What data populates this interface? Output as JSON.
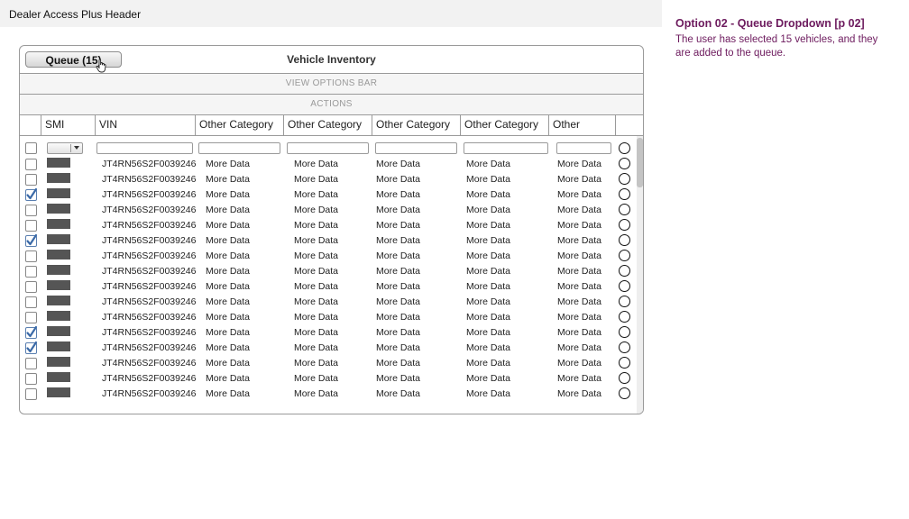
{
  "header": {
    "title": "Dealer Access Plus Header"
  },
  "note": {
    "title": "Option 02 - Queue Dropdown [p 02]",
    "body": "The user has selected 15 vehicles, and they are added to the queue."
  },
  "panel": {
    "queue_button": "Queue (15)",
    "title": "Vehicle Inventory",
    "view_options_bar": "VIEW OPTIONS BAR",
    "actions_bar": "ACTIONS"
  },
  "columns": [
    "SMI",
    "VIN",
    "Other Category",
    "Other Category",
    "Other Category",
    "Other Category",
    "Other"
  ],
  "rows": [
    {
      "vin": "JT4RN56S2F0039246",
      "checked": false,
      "c1": "More Data",
      "c2": "More Data",
      "c3": "More Data",
      "c4": "More Data",
      "c5": "More Data"
    },
    {
      "vin": "JT4RN56S2F0039246",
      "checked": false,
      "c1": "More Data",
      "c2": "More Data",
      "c3": "More Data",
      "c4": "More Data",
      "c5": "More Data"
    },
    {
      "vin": "JT4RN56S2F0039246",
      "checked": true,
      "c1": "More Data",
      "c2": "More Data",
      "c3": "More Data",
      "c4": "More Data",
      "c5": "More Data"
    },
    {
      "vin": "JT4RN56S2F0039246",
      "checked": false,
      "c1": "More Data",
      "c2": "More Data",
      "c3": "More Data",
      "c4": "More Data",
      "c5": "More Data"
    },
    {
      "vin": "JT4RN56S2F0039246",
      "checked": false,
      "c1": "More Data",
      "c2": "More Data",
      "c3": "More Data",
      "c4": "More Data",
      "c5": "More Data"
    },
    {
      "vin": "JT4RN56S2F0039246",
      "checked": true,
      "c1": "More Data",
      "c2": "More Data",
      "c3": "More Data",
      "c4": "More Data",
      "c5": "More Data"
    },
    {
      "vin": "JT4RN56S2F0039246",
      "checked": false,
      "c1": "More Data",
      "c2": "More Data",
      "c3": "More Data",
      "c4": "More Data",
      "c5": "More Data"
    },
    {
      "vin": "JT4RN56S2F0039246",
      "checked": false,
      "c1": "More Data",
      "c2": "More Data",
      "c3": "More Data",
      "c4": "More Data",
      "c5": "More Data"
    },
    {
      "vin": "JT4RN56S2F0039246",
      "checked": false,
      "c1": "More Data",
      "c2": "More Data",
      "c3": "More Data",
      "c4": "More Data",
      "c5": "More Data"
    },
    {
      "vin": "JT4RN56S2F0039246",
      "checked": false,
      "c1": "More Data",
      "c2": "More Data",
      "c3": "More Data",
      "c4": "More Data",
      "c5": "More Data"
    },
    {
      "vin": "JT4RN56S2F0039246",
      "checked": false,
      "c1": "More Data",
      "c2": "More Data",
      "c3": "More Data",
      "c4": "More Data",
      "c5": "More Data"
    },
    {
      "vin": "JT4RN56S2F0039246",
      "checked": true,
      "c1": "More Data",
      "c2": "More Data",
      "c3": "More Data",
      "c4": "More Data",
      "c5": "More Data"
    },
    {
      "vin": "JT4RN56S2F0039246",
      "checked": true,
      "c1": "More Data",
      "c2": "More Data",
      "c3": "More Data",
      "c4": "More Data",
      "c5": "More Data"
    },
    {
      "vin": "JT4RN56S2F0039246",
      "checked": false,
      "c1": "More Data",
      "c2": "More Data",
      "c3": "More Data",
      "c4": "More Data",
      "c5": "More Data"
    },
    {
      "vin": "JT4RN56S2F0039246",
      "checked": false,
      "c1": "More Data",
      "c2": "More Data",
      "c3": "More Data",
      "c4": "More Data",
      "c5": "More Data"
    },
    {
      "vin": "JT4RN56S2F0039246",
      "checked": false,
      "c1": "More Data",
      "c2": "More Data",
      "c3": "More Data",
      "c4": "More Data",
      "c5": "More Data"
    }
  ],
  "colors": {
    "note": "#6d1b5e",
    "swatch": "#555555",
    "check": "#3b6aa8"
  },
  "icons": {
    "cursor": "hand-pointer-icon",
    "dropdown": "chevron-down-icon",
    "checkmark": "checkmark-icon"
  }
}
